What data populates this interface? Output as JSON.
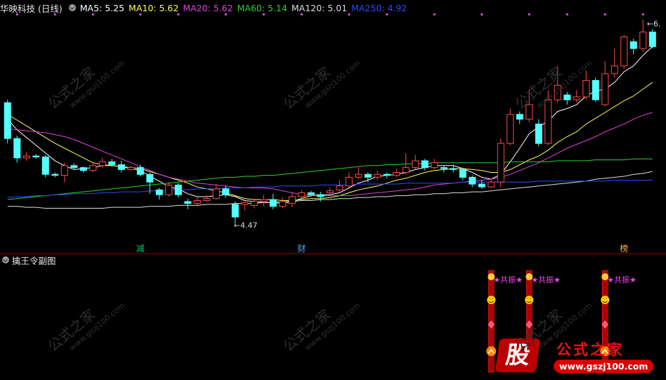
{
  "header": {
    "title": "华映科技 (日线)",
    "ma": [
      {
        "label": "MA5: 5.25",
        "color": "#ffffff"
      },
      {
        "label": "MA10: 5.62",
        "color": "#ffff55"
      },
      {
        "label": "MA20: 5.62",
        "color": "#e040e0"
      },
      {
        "label": "MA60: 5.14",
        "color": "#30d030"
      },
      {
        "label": "MA120: 5.01",
        "color": "#dddddd"
      },
      {
        "label": "MA250: 4.92",
        "color": "#2a4cff"
      }
    ]
  },
  "sub_panel": {
    "title": "擒王令副图",
    "signal_text": "★共振★"
  },
  "annotations": {
    "low_label": "←4.47",
    "high_label": "←6.",
    "event_1": "减",
    "event_2": "财",
    "event_3": "榜"
  },
  "watermark": {
    "text": "公式之家",
    "url": "www.gszj100.com"
  },
  "logo": {
    "char": "股",
    "name": "公式之家",
    "url": "www.gszj100.com"
  },
  "colors": {
    "up": "#ff4a4a",
    "down": "#54ffff",
    "bg": "#000000",
    "panel_border": "#8b0000"
  },
  "chart_data": {
    "type": "candlestick",
    "price_range": [
      4.3,
      6.65
    ],
    "candles": [
      [
        5.72,
        5.35,
        5.75,
        5.3
      ],
      [
        5.35,
        5.15,
        5.38,
        5.1
      ],
      [
        5.15,
        5.17,
        5.21,
        5.12
      ],
      [
        5.17,
        5.16,
        5.19,
        5.14
      ],
      [
        5.16,
        4.98,
        5.18,
        4.95
      ],
      [
        4.98,
        4.97,
        5.0,
        4.95
      ],
      [
        4.97,
        5.07,
        5.1,
        4.9
      ],
      [
        5.07,
        5.05,
        5.09,
        5.03
      ],
      [
        5.05,
        5.02,
        5.06,
        5.0
      ],
      [
        5.02,
        5.07,
        5.1,
        5.0
      ],
      [
        5.07,
        5.11,
        5.15,
        5.05
      ],
      [
        5.11,
        5.08,
        5.14,
        5.06
      ],
      [
        5.08,
        5.03,
        5.12,
        5.0
      ],
      [
        5.03,
        5.05,
        5.07,
        5.02
      ],
      [
        5.05,
        4.98,
        5.08,
        4.96
      ],
      [
        4.98,
        4.9,
        5.0,
        4.78
      ],
      [
        4.82,
        4.77,
        4.84,
        4.72
      ],
      [
        4.77,
        4.87,
        4.9,
        4.75
      ],
      [
        4.87,
        4.77,
        4.89,
        4.74
      ],
      [
        4.7,
        4.68,
        4.73,
        4.62
      ],
      [
        4.68,
        4.71,
        4.74,
        4.65
      ],
      [
        4.71,
        4.73,
        4.76,
        4.7
      ],
      [
        4.73,
        4.83,
        4.88,
        4.72
      ],
      [
        4.83,
        4.77,
        4.86,
        4.74
      ],
      [
        4.67,
        4.54,
        4.7,
        4.47
      ],
      [
        4.67,
        4.69,
        4.7,
        4.61
      ],
      [
        4.66,
        4.7,
        4.73,
        4.63
      ],
      [
        4.7,
        4.72,
        4.77,
        4.65
      ],
      [
        4.72,
        4.65,
        4.78,
        4.62
      ],
      [
        4.65,
        4.7,
        4.74,
        4.63
      ],
      [
        4.68,
        4.75,
        4.79,
        4.64
      ],
      [
        4.75,
        4.79,
        4.82,
        4.73
      ],
      [
        4.79,
        4.77,
        4.81,
        4.75
      ],
      [
        4.77,
        4.75,
        4.8,
        4.7
      ],
      [
        4.79,
        4.81,
        4.84,
        4.76
      ],
      [
        4.82,
        4.86,
        4.92,
        4.8
      ],
      [
        4.86,
        4.95,
        5.0,
        4.85
      ],
      [
        4.95,
        4.98,
        5.05,
        4.93
      ],
      [
        4.98,
        4.95,
        5.0,
        4.9
      ],
      [
        4.95,
        4.98,
        5.02,
        4.92
      ],
      [
        4.98,
        4.97,
        5.0,
        4.94
      ],
      [
        4.97,
        5.0,
        5.04,
        4.95
      ],
      [
        5.0,
        5.05,
        5.2,
        4.98
      ],
      [
        5.05,
        5.12,
        5.18,
        5.03
      ],
      [
        5.12,
        5.05,
        5.14,
        5.02
      ],
      [
        5.05,
        5.1,
        5.14,
        5.03
      ],
      [
        5.05,
        5.04,
        5.07,
        5.0
      ],
      [
        5.04,
        5.03,
        5.08,
        5.0
      ],
      [
        5.03,
        4.95,
        5.05,
        4.92
      ],
      [
        4.95,
        4.88,
        4.97,
        4.85
      ],
      [
        4.88,
        4.85,
        4.92,
        4.83
      ],
      [
        4.85,
        4.9,
        4.93,
        4.84
      ],
      [
        4.9,
        5.3,
        5.35,
        4.85
      ],
      [
        5.3,
        5.6,
        5.66,
        5.28
      ],
      [
        5.6,
        5.55,
        5.63,
        5.5
      ],
      [
        5.55,
        5.7,
        5.86,
        5.52
      ],
      [
        5.5,
        5.3,
        5.55,
        5.27
      ],
      [
        5.3,
        5.75,
        5.85,
        5.28
      ],
      [
        5.75,
        5.9,
        6.1,
        5.72
      ],
      [
        5.8,
        5.75,
        5.83,
        5.7
      ],
      [
        5.75,
        5.78,
        5.85,
        5.72
      ],
      [
        5.78,
        5.95,
        6.05,
        5.75
      ],
      [
        5.95,
        5.75,
        5.98,
        5.73
      ],
      [
        5.7,
        6.02,
        6.15,
        5.68
      ],
      [
        6.02,
        6.1,
        6.28,
        5.98
      ],
      [
        6.1,
        6.4,
        6.42,
        6.07
      ],
      [
        6.35,
        6.28,
        6.38,
        6.22
      ],
      [
        6.28,
        6.45,
        6.58,
        6.25
      ],
      [
        6.45,
        6.3,
        6.48,
        6.28
      ]
    ],
    "ma_lines": {
      "MA5": [
        5.55,
        5.44,
        5.36,
        5.28,
        5.2,
        5.12,
        5.07,
        5.03,
        5.04,
        5.05,
        5.07,
        5.07,
        5.06,
        5.04,
        5.02,
        4.96,
        4.91,
        4.85,
        4.83,
        4.78,
        4.75,
        4.75,
        4.76,
        4.77,
        4.75,
        4.71,
        4.7,
        4.69,
        4.69,
        4.68,
        4.7,
        4.73,
        4.76,
        4.77,
        4.77,
        4.79,
        4.84,
        4.89,
        4.92,
        4.96,
        4.97,
        4.98,
        5.0,
        5.03,
        5.05,
        5.07,
        5.07,
        5.07,
        5.04,
        5.0,
        4.95,
        4.93,
        4.98,
        5.11,
        5.25,
        5.4,
        5.47,
        5.53,
        5.63,
        5.66,
        5.7,
        5.79,
        5.84,
        5.86,
        5.93,
        6.04,
        6.1,
        6.21,
        6.3
      ],
      "MA10": [
        5.6,
        5.54,
        5.48,
        5.42,
        5.36,
        5.3,
        5.25,
        5.2,
        5.15,
        5.1,
        5.08,
        5.07,
        5.06,
        5.05,
        5.04,
        5.01,
        4.98,
        4.95,
        4.92,
        4.89,
        4.85,
        4.83,
        4.81,
        4.79,
        4.76,
        4.73,
        4.72,
        4.72,
        4.72,
        4.71,
        4.71,
        4.72,
        4.73,
        4.73,
        4.74,
        4.76,
        4.79,
        4.82,
        4.84,
        4.86,
        4.89,
        4.92,
        4.94,
        4.97,
        5.0,
        5.02,
        5.03,
        5.04,
        5.04,
        5.03,
        5.02,
        5.0,
        5.0,
        5.03,
        5.08,
        5.13,
        5.17,
        5.23,
        5.31,
        5.37,
        5.42,
        5.5,
        5.56,
        5.62,
        5.68,
        5.74,
        5.79,
        5.86,
        5.93
      ],
      "MA20": [
        5.45,
        5.44,
        5.43,
        5.42,
        5.41,
        5.39,
        5.37,
        5.34,
        5.3,
        5.26,
        5.22,
        5.18,
        5.14,
        5.1,
        5.06,
        5.02,
        4.98,
        4.95,
        4.93,
        4.91,
        4.89,
        4.88,
        4.87,
        4.86,
        4.85,
        4.84,
        4.84,
        4.84,
        4.83,
        4.81,
        4.79,
        4.77,
        4.76,
        4.76,
        4.76,
        4.76,
        4.76,
        4.77,
        4.78,
        4.79,
        4.8,
        4.81,
        4.82,
        4.83,
        4.85,
        4.87,
        4.88,
        4.89,
        4.9,
        4.91,
        4.92,
        4.93,
        4.95,
        4.98,
        5.02,
        5.06,
        5.1,
        5.15,
        5.2,
        5.25,
        5.29,
        5.33,
        5.37,
        5.42,
        5.46,
        5.5,
        5.55,
        5.59,
        5.62
      ],
      "MA60": [
        4.72,
        4.73,
        4.74,
        4.75,
        4.76,
        4.77,
        4.78,
        4.79,
        4.8,
        4.81,
        4.82,
        4.83,
        4.84,
        4.85,
        4.86,
        4.87,
        4.88,
        4.89,
        4.9,
        4.91,
        4.92,
        4.93,
        4.94,
        4.95,
        4.95,
        4.96,
        4.96,
        4.97,
        4.97,
        4.98,
        4.99,
        5.0,
        5.01,
        5.02,
        5.03,
        5.04,
        5.05,
        5.06,
        5.07,
        5.07,
        5.08,
        5.08,
        5.09,
        5.09,
        5.09,
        5.1,
        5.1,
        5.1,
        5.1,
        5.1,
        5.1,
        5.1,
        5.1,
        5.11,
        5.11,
        5.11,
        5.11,
        5.11,
        5.12,
        5.12,
        5.12,
        5.12,
        5.13,
        5.13,
        5.13,
        5.13,
        5.14,
        5.14,
        5.14
      ],
      "MA120": [
        4.65,
        4.65,
        4.64,
        4.64,
        4.63,
        4.63,
        4.63,
        4.63,
        4.63,
        4.63,
        4.63,
        4.64,
        4.64,
        4.64,
        4.64,
        4.65,
        4.65,
        4.65,
        4.66,
        4.66,
        4.66,
        4.67,
        4.67,
        4.67,
        4.68,
        4.68,
        4.68,
        4.69,
        4.69,
        4.7,
        4.7,
        4.71,
        4.71,
        4.72,
        4.72,
        4.73,
        4.73,
        4.74,
        4.74,
        4.75,
        4.75,
        4.76,
        4.76,
        4.77,
        4.77,
        4.78,
        4.78,
        4.79,
        4.79,
        4.8,
        4.8,
        4.81,
        4.82,
        4.83,
        4.84,
        4.85,
        4.86,
        4.87,
        4.88,
        4.89,
        4.9,
        4.91,
        4.93,
        4.94,
        4.95,
        4.96,
        4.98,
        4.99,
        5.01
      ],
      "MA250": [
        4.74,
        4.75,
        4.75,
        4.76,
        4.76,
        4.77,
        4.77,
        4.78,
        4.78,
        4.78,
        4.79,
        4.79,
        4.8,
        4.8,
        4.8,
        4.81,
        4.81,
        4.82,
        4.82,
        4.82,
        4.83,
        4.83,
        4.83,
        4.84,
        4.84,
        4.84,
        4.85,
        4.85,
        4.85,
        4.86,
        4.86,
        4.86,
        4.86,
        4.87,
        4.87,
        4.87,
        4.87,
        4.88,
        4.88,
        4.88,
        4.88,
        4.88,
        4.89,
        4.89,
        4.89,
        4.89,
        4.89,
        4.89,
        4.9,
        4.9,
        4.9,
        4.9,
        4.9,
        4.9,
        4.9,
        4.9,
        4.91,
        4.91,
        4.91,
        4.91,
        4.91,
        4.91,
        4.91,
        4.91,
        4.92,
        4.92,
        4.92,
        4.92,
        4.92
      ]
    },
    "top_marker_indices": [
      1,
      5,
      9,
      14,
      18,
      23,
      27,
      31,
      36,
      40,
      45,
      50,
      55,
      59,
      63,
      67
    ],
    "event_markers": [
      {
        "index": 14,
        "label": "减"
      },
      {
        "index": 31,
        "label": "财"
      },
      {
        "index": 65,
        "label": "榜"
      }
    ],
    "signal_columns": [
      51,
      55,
      63
    ]
  }
}
